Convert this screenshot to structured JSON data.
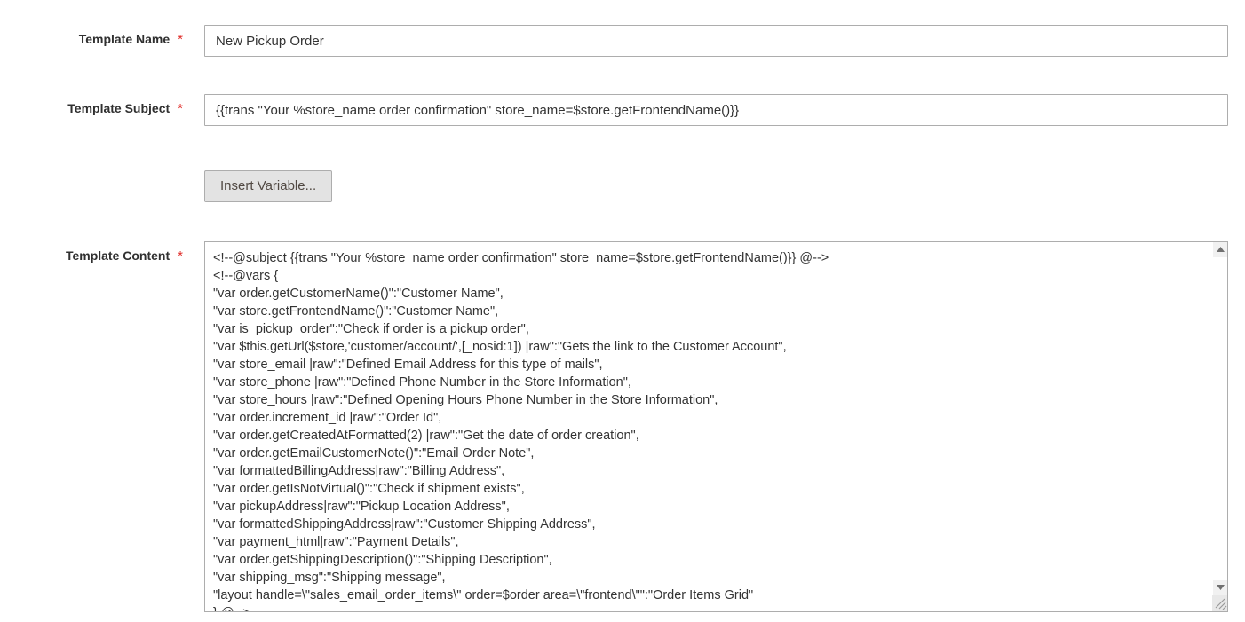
{
  "form": {
    "fields": {
      "template_name": {
        "label": "Template Name",
        "required_marker": "*",
        "value": "New Pickup Order",
        "placeholder": "Template Name"
      },
      "template_subject": {
        "label": "Template Subject",
        "required_marker": "*",
        "value": "{{trans \"Your %store_name order confirmation\" store_name=$store.getFrontendName()}}",
        "placeholder": "Template Subject"
      },
      "template_content": {
        "label": "Template Content",
        "required_marker": "*",
        "value": "<!--@subject {{trans \"Your %store_name order confirmation\" store_name=$store.getFrontendName()}} @-->\n<!--@vars {\n\"var order.getCustomerName()\":\"Customer Name\",\n\"var store.getFrontendName()\":\"Customer Name\",\n\"var is_pickup_order\":\"Check if order is a pickup order\",\n\"var $this.getUrl($store,'customer/account/',[_nosid:1]) |raw\":\"Gets the link to the Customer Account\",\n\"var store_email |raw\":\"Defined Email Address for this type of mails\",\n\"var store_phone |raw\":\"Defined Phone Number in the Store Information\",\n\"var store_hours |raw\":\"Defined Opening Hours Phone Number in the Store Information\",\n\"var order.increment_id |raw\":\"Order Id\",\n\"var order.getCreatedAtFormatted(2) |raw\":\"Get the date of order creation\",\n\"var order.getEmailCustomerNote()\":\"Email Order Note\",\n\"var formattedBillingAddress|raw\":\"Billing Address\",\n\"var order.getIsNotVirtual()\":\"Check if shipment exists\",\n\"var pickupAddress|raw\":\"Pickup Location Address\",\n\"var formattedShippingAddress|raw\":\"Customer Shipping Address\",\n\"var payment_html|raw\":\"Payment Details\",\n\"var order.getShippingDescription()\":\"Shipping Description\",\n\"var shipping_msg\":\"Shipping message\",\n\"layout handle=\\\"sales_email_order_items\\\" order=$order area=\\\"frontend\\\"\":\"Order Items Grid\"\n} @-->",
        "placeholder": "Template Content"
      }
    },
    "buttons": {
      "insert_variable": "Insert Variable..."
    }
  },
  "colors": {
    "required_star": "#e02b27",
    "label_text": "#303030",
    "input_border": "#adadad",
    "button_background": "#e3e3e3",
    "button_text": "#514943",
    "scrollbar_thumb": "#c1c1c1",
    "scrollbar_track": "#f1f1f1"
  }
}
